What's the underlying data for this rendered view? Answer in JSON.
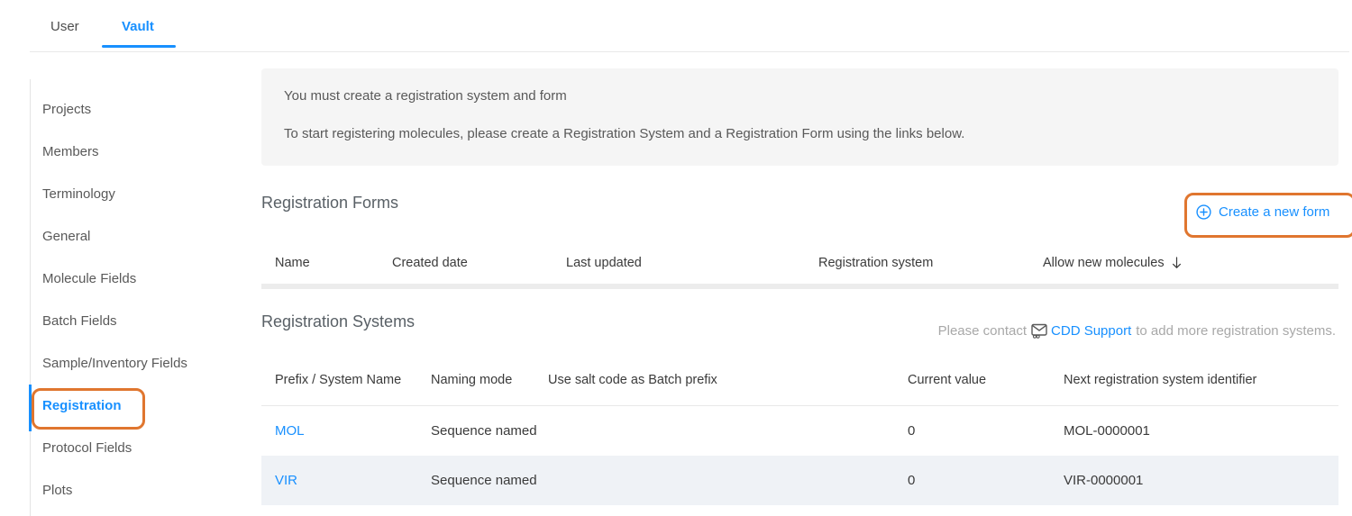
{
  "tabs": [
    {
      "label": "User"
    },
    {
      "label": "Vault"
    }
  ],
  "sidebar": {
    "items": [
      "Projects",
      "Members",
      "Terminology",
      "General",
      "Molecule Fields",
      "Batch Fields",
      "Sample/Inventory Fields",
      "Registration",
      "Protocol Fields",
      "Plots"
    ],
    "active_item": "Registration"
  },
  "notice": {
    "line1": "You must create a registration system and form",
    "line2": "To start registering molecules, please create a Registration System and a Registration Form using the links below."
  },
  "forms_section": {
    "title": "Registration Forms",
    "create_button_label": "Create a new form",
    "columns": [
      "Name",
      "Created date",
      "Last updated",
      "Registration system",
      "Allow new molecules"
    ],
    "rows": []
  },
  "systems_section": {
    "title": "Registration Systems",
    "contact_note": {
      "prefix": "Please contact",
      "link_label": "CDD Support",
      "suffix": "to add more registration systems."
    },
    "columns": [
      "Prefix / System Name",
      "Naming mode",
      "Use salt code as Batch prefix",
      "Current value",
      "Next registration system identifier"
    ],
    "rows": [
      {
        "prefix_system_name": "MOL",
        "naming_mode": "Sequence named",
        "use_salt_code": "",
        "current_value": "0",
        "next_identifier": "MOL-0000001"
      },
      {
        "prefix_system_name": "VIR",
        "naming_mode": "Sequence named",
        "use_salt_code": "",
        "current_value": "0",
        "next_identifier": "VIR-0000001"
      }
    ]
  },
  "icons": {
    "create_form": "plus-circle",
    "sort_indicator": "arrow-down",
    "contact_support": "envelope"
  },
  "colors": {
    "accent_blue": "#1890ff",
    "annotation_orange": "#e0762f",
    "row_alt_background": "#eff2f6",
    "notice_background": "#f5f5f5"
  }
}
